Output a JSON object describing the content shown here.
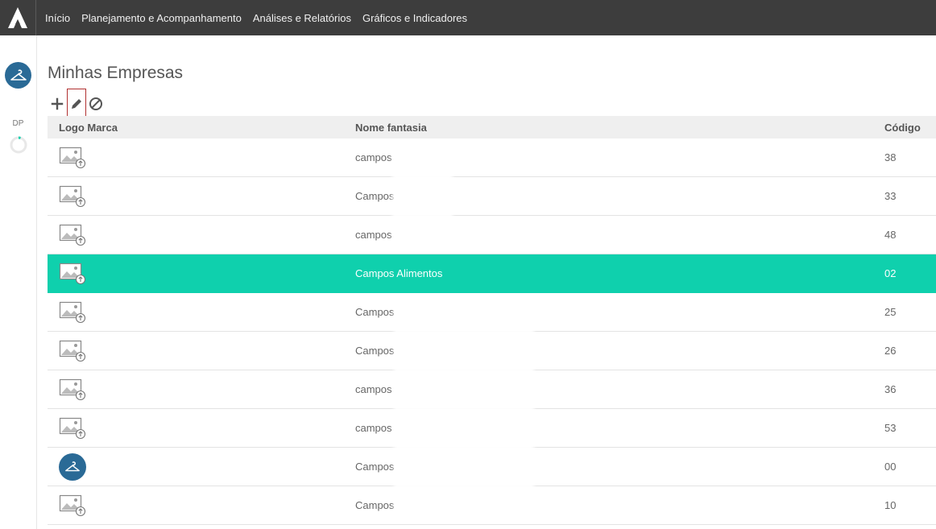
{
  "nav": {
    "items": [
      {
        "label": "Início"
      },
      {
        "label": "Planejamento e Acompanhamento"
      },
      {
        "label": "Análises e Relatórios"
      },
      {
        "label": "Gráficos e Indicadores"
      }
    ]
  },
  "sidebar": {
    "module_label": "DP"
  },
  "page": {
    "title": "Minhas Empresas"
  },
  "toolbar": {
    "add": "plus-icon",
    "edit": "pencil-icon",
    "disable": "block-icon"
  },
  "table": {
    "columns": {
      "logo": "Logo Marca",
      "name": "Nome fantasia",
      "code": "Código"
    },
    "rows": [
      {
        "name": "campos",
        "code": "38",
        "logo": "image-upload-icon",
        "selected": false
      },
      {
        "name": "Campos",
        "code": "33",
        "logo": "image-upload-icon",
        "selected": false
      },
      {
        "name": "campos",
        "code": "48",
        "logo": "image-upload-icon",
        "selected": false
      },
      {
        "name": "Campos Alimentos",
        "code": "02",
        "logo": "image-upload-icon",
        "selected": true
      },
      {
        "name": "Campos",
        "code": "25",
        "logo": "image-upload-icon",
        "selected": false
      },
      {
        "name": "Campos",
        "code": "26",
        "logo": "image-upload-icon",
        "selected": false
      },
      {
        "name": "campos",
        "code": "36",
        "logo": "image-upload-icon",
        "selected": false
      },
      {
        "name": "campos",
        "code": "53",
        "logo": "image-upload-icon",
        "selected": false
      },
      {
        "name": "Campos",
        "code": "00",
        "logo": "hanger-logo",
        "selected": false
      },
      {
        "name": "Campos",
        "code": "10",
        "logo": "image-upload-icon",
        "selected": false
      }
    ]
  },
  "colors": {
    "topbar": "#3d3d3d",
    "accent": "#0fd0ad",
    "brand": "#2a6a96"
  }
}
